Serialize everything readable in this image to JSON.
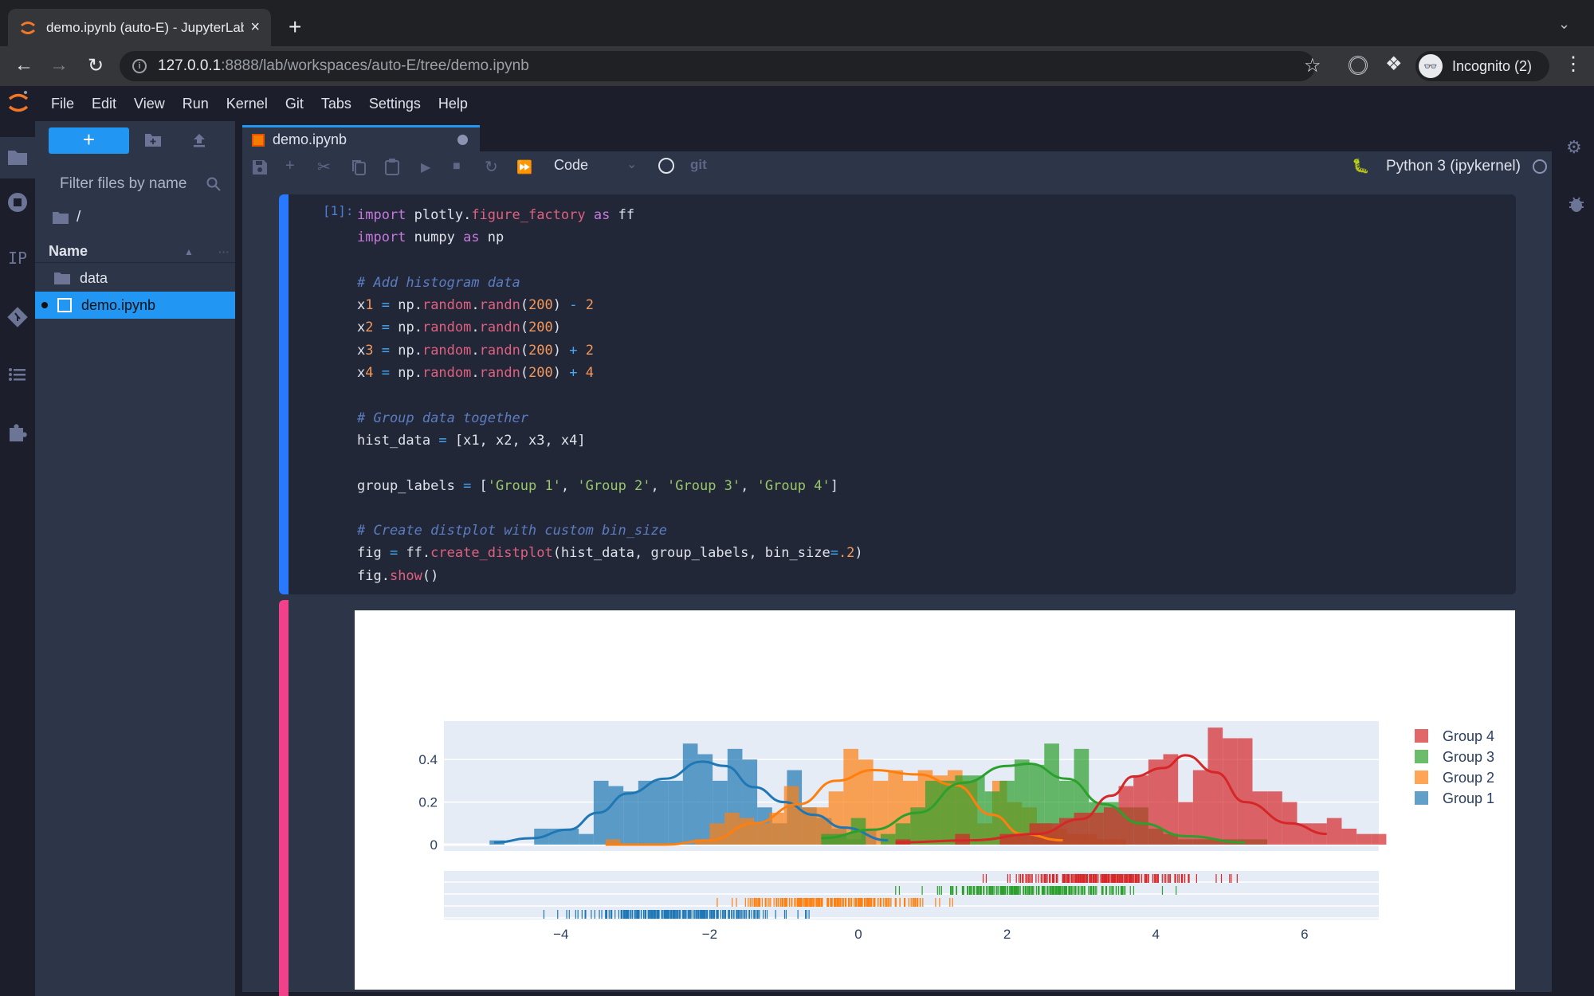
{
  "browser": {
    "tab_title": "demo.ipynb (auto-E) - JupyterLab",
    "url_host": "127.0.0.1",
    "url_rest": ":8888/lab/workspaces/auto-E/tree/demo.ipynb",
    "profile_label": "Incognito (2)",
    "new_tab": "+",
    "close_tab": "×"
  },
  "menubar": {
    "items": [
      "File",
      "Edit",
      "View",
      "Run",
      "Kernel",
      "Git",
      "Tabs",
      "Settings",
      "Help"
    ]
  },
  "filebrowser": {
    "new_button": "+",
    "filter_placeholder": "Filter files by name",
    "breadcrumb": "/",
    "column_name": "Name",
    "files": [
      {
        "name": "data",
        "type": "folder",
        "selected": false,
        "running": false
      },
      {
        "name": "demo.ipynb",
        "type": "notebook",
        "selected": true,
        "running": true
      }
    ]
  },
  "leftbar": {
    "icons": [
      "folder-icon",
      "running-icon",
      "property-inspector-icon",
      "git-icon",
      "toc-icon",
      "extension-icon"
    ],
    "ip_label": "IP"
  },
  "notebook": {
    "tab_title": "demo.ipynb",
    "cell_type": "Code",
    "git_label": "git",
    "kernel_name": "Python 3 (ipykernel)",
    "cell_prompt": "[1]:",
    "code_lines": [
      "import plotly.figure_factory as ff",
      "import numpy as np",
      "",
      "# Add histogram data",
      "x1 = np.random.randn(200) - 2",
      "x2 = np.random.randn(200)",
      "x3 = np.random.randn(200) + 2",
      "x4 = np.random.randn(200) + 4",
      "",
      "# Group data together",
      "hist_data = [x1, x2, x3, x4]",
      "",
      "group_labels = ['Group 1', 'Group 2', 'Group 3', 'Group 4']",
      "",
      "# Create distplot with custom bin_size",
      "fig = ff.create_distplot(hist_data, group_labels, bin_size=.2)",
      "fig.show()"
    ]
  },
  "chart_data": {
    "type": "histogram",
    "title": "",
    "xlabel": "",
    "ylabel": "",
    "x_ticks": [
      -4,
      -2,
      0,
      2,
      4,
      6
    ],
    "y_ticks": [
      0,
      0.2,
      0.4
    ],
    "xlim": [
      -5.6,
      7.0
    ],
    "ylim": [
      -0.02,
      0.58
    ],
    "bin_size": 0.2,
    "grid": true,
    "legend_position": "right",
    "legend": [
      "Group 4",
      "Group 3",
      "Group 2",
      "Group 1"
    ],
    "series": [
      {
        "name": "Group 1",
        "color": "#1f77b4",
        "bins_start": -4.96,
        "densities": [
          0.02,
          0,
          0,
          0.075,
          0.075,
          0.075,
          0.05,
          0.3,
          0.275,
          0.25,
          0.3,
          0.3,
          0.3,
          0.475,
          0.425,
          0.3,
          0.45,
          0.4,
          0.175,
          0.1,
          0.35,
          0.175,
          0.125,
          0.075,
          0.025,
          0.075
        ],
        "kde": [
          [
            -4.9,
            0.01
          ],
          [
            -4.4,
            0.03
          ],
          [
            -3.9,
            0.07
          ],
          [
            -3.5,
            0.15
          ],
          [
            -3.1,
            0.24
          ],
          [
            -2.6,
            0.31
          ],
          [
            -2.1,
            0.39
          ],
          [
            -1.8,
            0.37
          ],
          [
            -1.4,
            0.27
          ],
          [
            -1.0,
            0.2
          ],
          [
            -0.6,
            0.14
          ],
          [
            -0.2,
            0.08
          ],
          [
            0.4,
            0.02
          ]
        ],
        "rug_range": [
          -4.96,
          0.4
        ]
      },
      {
        "name": "Group 2",
        "color": "#ff7f0e",
        "bins_start": -3.4,
        "densities": [
          0.025,
          0,
          0,
          0,
          0,
          0,
          0.025,
          0.1,
          0.15,
          0.125,
          0.1,
          0.15,
          0.275,
          0.175,
          0.175,
          0.25,
          0.45,
          0.4,
          0.3,
          0.35,
          0.3,
          0.35,
          0.325,
          0.35,
          0.3,
          0.1,
          0.3,
          0.2,
          0.175,
          0.1,
          0.075,
          0.05,
          0.05,
          0.025,
          0.025
        ],
        "kde": [
          [
            -3.4,
            0.0
          ],
          [
            -2.6,
            0.0
          ],
          [
            -2.0,
            0.02
          ],
          [
            -1.4,
            0.1
          ],
          [
            -0.8,
            0.19
          ],
          [
            -0.3,
            0.3
          ],
          [
            0.2,
            0.35
          ],
          [
            0.8,
            0.33
          ],
          [
            1.3,
            0.28
          ],
          [
            1.8,
            0.14
          ],
          [
            2.2,
            0.05
          ],
          [
            2.75,
            0.02
          ]
        ],
        "rug_range": [
          -3.4,
          2.8
        ]
      },
      {
        "name": "Group 3",
        "color": "#2ca02c",
        "bins_start": -0.5,
        "densities": [
          0.05,
          0.05,
          0.125,
          0,
          0.05,
          0.1,
          0.175,
          0.3,
          0.3,
          0.325,
          0.325,
          0.25,
          0.3,
          0.4,
          0.375,
          0.475,
          0.3,
          0.45,
          0.2,
          0.2,
          0.175,
          0.175,
          0.075,
          0.05,
          0.025,
          0.025,
          0.025,
          0.025,
          0.025,
          0.025
        ],
        "kde": [
          [
            -0.5,
            0.03
          ],
          [
            0.2,
            0.07
          ],
          [
            0.8,
            0.15
          ],
          [
            1.4,
            0.29
          ],
          [
            2.0,
            0.37
          ],
          [
            2.3,
            0.38
          ],
          [
            2.8,
            0.31
          ],
          [
            3.3,
            0.19
          ],
          [
            3.8,
            0.1
          ],
          [
            4.4,
            0.04
          ],
          [
            5.2,
            0.01
          ]
        ],
        "rug_range": [
          -0.5,
          5.2
        ]
      },
      {
        "name": "Group 4",
        "color": "#d62728",
        "bins_start": 0.5,
        "densities": [
          0.025,
          0,
          0,
          0,
          0.05,
          0,
          0,
          0.05,
          0.05,
          0.1,
          0.1,
          0.125,
          0.15,
          0.15,
          0.175,
          0.275,
          0.325,
          0.4,
          0.425,
          0.2,
          0.35,
          0.55,
          0.5,
          0.5,
          0.25,
          0.25,
          0.2,
          0.1,
          0.1,
          0.125,
          0.075,
          0.05,
          0.05
        ],
        "kde": [
          [
            0.5,
            0.01
          ],
          [
            1.5,
            0.02
          ],
          [
            2.4,
            0.05
          ],
          [
            3.0,
            0.12
          ],
          [
            3.4,
            0.23
          ],
          [
            3.7,
            0.32
          ],
          [
            4.1,
            0.36
          ],
          [
            4.4,
            0.42
          ],
          [
            4.8,
            0.34
          ],
          [
            5.2,
            0.2
          ],
          [
            5.8,
            0.1
          ],
          [
            6.3,
            0.05
          ]
        ],
        "rug_range": [
          0.5,
          6.3
        ]
      }
    ]
  }
}
